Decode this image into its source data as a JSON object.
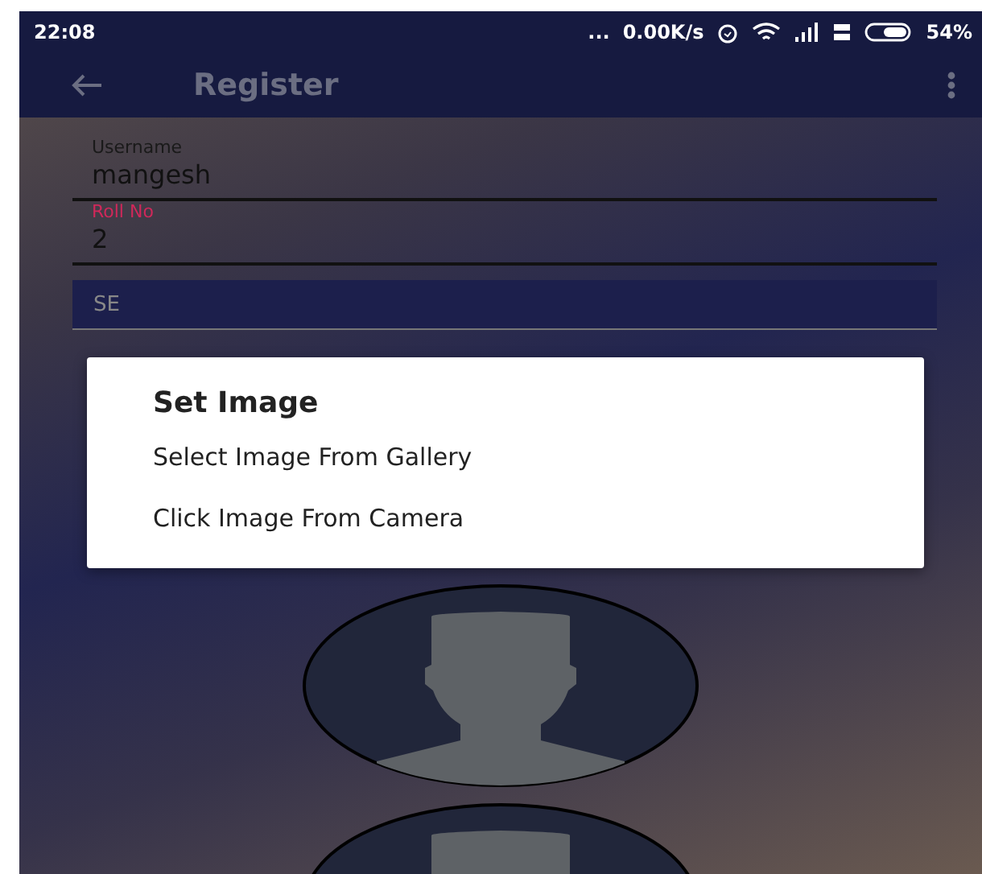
{
  "status_bar": {
    "time": "22:08",
    "dots": "...",
    "speed": "0.00K/s",
    "battery": "54%"
  },
  "app_bar": {
    "title": "Register"
  },
  "form": {
    "fields": [
      {
        "label": "Username",
        "value": "mangesh",
        "focused": false
      },
      {
        "label": "Roll No",
        "value": "2",
        "focused": true
      }
    ],
    "spinner": {
      "value": "SE"
    }
  },
  "dialog": {
    "title": "Set Image",
    "options": [
      "Select Image From Gallery",
      "Click Image From Camera"
    ]
  }
}
